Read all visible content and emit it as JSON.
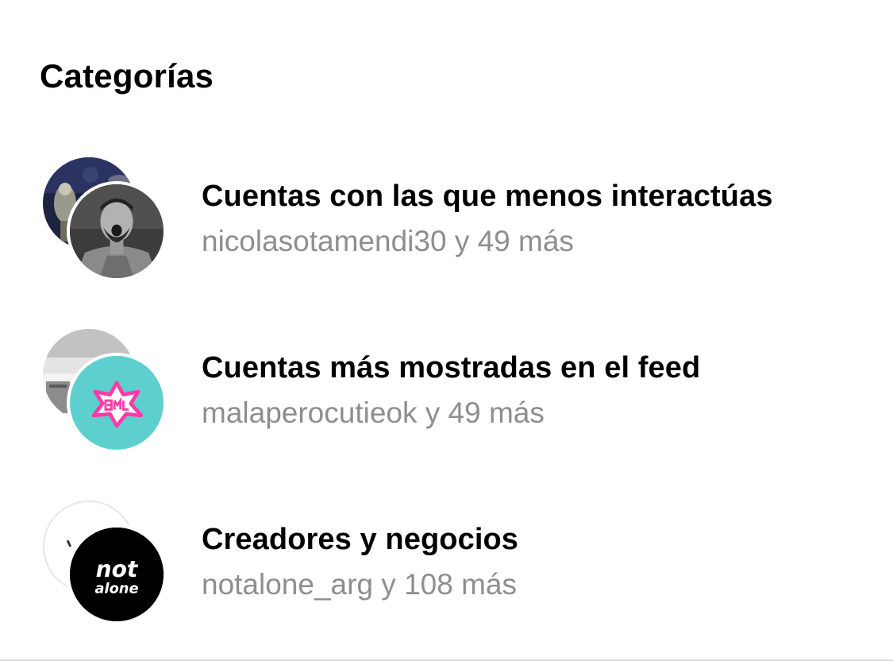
{
  "section": {
    "title": "Categorías"
  },
  "categories": [
    {
      "title": "Cuentas con las que menos interactúas",
      "subtitle": "nicolasotamendi30 y 49 más",
      "back_avatar_icon": "trophy-photo-avatar",
      "front_avatar_icon": "footballer-photo-avatar"
    },
    {
      "title": "Cuentas más mostradas en el feed",
      "subtitle": "malaperocutieok y 49 más",
      "back_avatar_icon": "grey-photo-avatar",
      "front_avatar_icon": "emilia-star-logo-avatar",
      "front_avatar_color": "#5ecfcf",
      "front_avatar_accent": "#ff3aa8"
    },
    {
      "title": "Creadores y negocios",
      "subtitle": "notalone_arg y 108 más",
      "back_avatar_icon": "white-avatar",
      "front_avatar_icon": "not-alone-logo-avatar",
      "front_avatar_logo_line1": "not",
      "front_avatar_logo_line2": "alone"
    }
  ]
}
